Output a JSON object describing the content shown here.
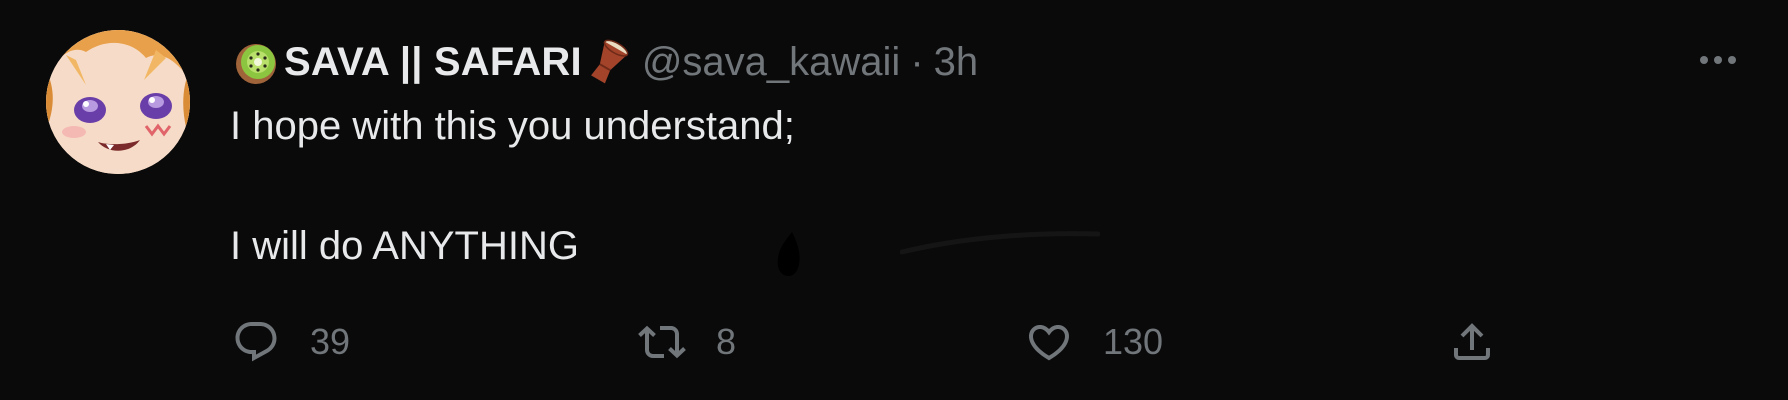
{
  "tweet": {
    "author": {
      "display_name": "SAVA || SAFARI",
      "handle": "@sava_kawaii",
      "name_emoji_left": "kiwi-fruit",
      "name_emoji_right": "drum"
    },
    "separator": "·",
    "time": "3h",
    "text_lines": [
      "I hope with this you understand;",
      "I will do ANYTHING"
    ],
    "actions": {
      "reply_count": "39",
      "retweet_count": "8",
      "like_count": "130"
    }
  },
  "colors": {
    "background": "#0a0a0a",
    "text_primary": "#e7e9ea",
    "text_secondary": "#71767b"
  },
  "icons": {
    "more": "more-horizontal-icon",
    "reply": "reply-icon",
    "retweet": "retweet-icon",
    "like": "heart-icon",
    "share": "share-icon"
  }
}
